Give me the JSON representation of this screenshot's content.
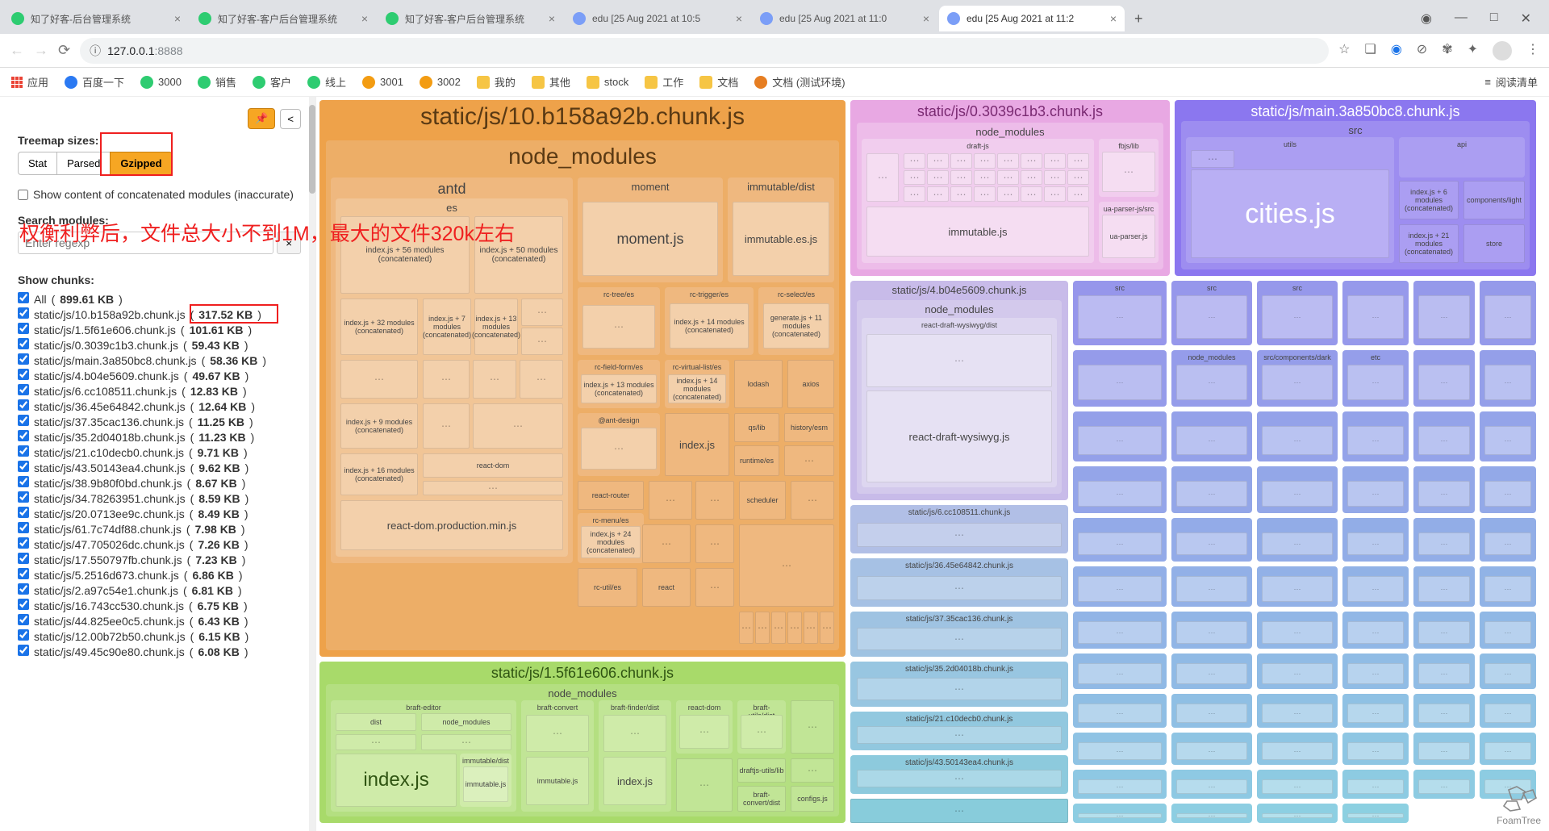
{
  "browser": {
    "tabs": [
      {
        "title": "知了好客-后台管理系统",
        "favicon": "#2ecc71"
      },
      {
        "title": "知了好客-客户后台管理系统",
        "favicon": "#2ecc71"
      },
      {
        "title": "知了好客-客户后台管理系统",
        "favicon": "#2ecc71"
      },
      {
        "title": "edu [25 Aug 2021 at 10:5",
        "favicon": "#7b9ef7"
      },
      {
        "title": "edu [25 Aug 2021 at 11:0",
        "favicon": "#7b9ef7"
      },
      {
        "title": "edu [25 Aug 2021 at 11:2",
        "favicon": "#7b9ef7",
        "active": true
      }
    ],
    "url_prefix": "ⓘ",
    "url_host": "127.0.0.1",
    "url_port": ":8888",
    "reading_list": "阅读清单"
  },
  "bookmarks": [
    {
      "label": "应用",
      "color": "#ff5722"
    },
    {
      "label": "百度一下",
      "color": "#2b79f2"
    },
    {
      "label": "3000",
      "color": "#2ecc71"
    },
    {
      "label": "销售",
      "color": "#2ecc71"
    },
    {
      "label": "客户",
      "color": "#2ecc71"
    },
    {
      "label": "线上",
      "color": "#2ecc71"
    },
    {
      "label": "3001",
      "color": "#f39c12"
    },
    {
      "label": "3002",
      "color": "#f39c12"
    },
    {
      "label": "我的",
      "folder": true
    },
    {
      "label": "其他",
      "folder": true
    },
    {
      "label": "stock",
      "folder": true
    },
    {
      "label": "工作",
      "folder": true
    },
    {
      "label": "文档",
      "folder": true
    },
    {
      "label": "文档 (测试环境)",
      "color": "#e67e22"
    }
  ],
  "sidebar": {
    "sizes_label": "Treemap sizes:",
    "stat": "Stat",
    "parsed": "Parsed",
    "gzipped": "Gzipped",
    "show_concat": "Show content of concatenated modules (inaccurate)",
    "search_label": "Search modules:",
    "search_placeholder": "Enter regexp",
    "clear": "×",
    "annotation": "权衡利弊后，文件总大小不到1M，最大的文件320k左右",
    "chunks_label": "Show chunks:",
    "chunks": [
      {
        "name": "All",
        "size": "899.61 KB"
      },
      {
        "name": "static/js/10.b158a92b.chunk.js",
        "size": "317.52 KB",
        "hl": true
      },
      {
        "name": "static/js/1.5f61e606.chunk.js",
        "size": "101.61 KB"
      },
      {
        "name": "static/js/0.3039c1b3.chunk.js",
        "size": "59.43 KB"
      },
      {
        "name": "static/js/main.3a850bc8.chunk.js",
        "size": "58.36 KB"
      },
      {
        "name": "static/js/4.b04e5609.chunk.js",
        "size": "49.67 KB"
      },
      {
        "name": "static/js/6.cc108511.chunk.js",
        "size": "12.83 KB"
      },
      {
        "name": "static/js/36.45e64842.chunk.js",
        "size": "12.64 KB"
      },
      {
        "name": "static/js/37.35cac136.chunk.js",
        "size": "11.25 KB"
      },
      {
        "name": "static/js/35.2d04018b.chunk.js",
        "size": "11.23 KB"
      },
      {
        "name": "static/js/21.c10decb0.chunk.js",
        "size": "9.71 KB"
      },
      {
        "name": "static/js/43.50143ea4.chunk.js",
        "size": "9.62 KB"
      },
      {
        "name": "static/js/38.9b80f0bd.chunk.js",
        "size": "8.67 KB"
      },
      {
        "name": "static/js/34.78263951.chunk.js",
        "size": "8.59 KB"
      },
      {
        "name": "static/js/20.0713ee9c.chunk.js",
        "size": "8.49 KB"
      },
      {
        "name": "static/js/61.7c74df88.chunk.js",
        "size": "7.98 KB"
      },
      {
        "name": "static/js/47.705026dc.chunk.js",
        "size": "7.26 KB"
      },
      {
        "name": "static/js/17.550797fb.chunk.js",
        "size": "7.23 KB"
      },
      {
        "name": "static/js/5.2516d673.chunk.js",
        "size": "6.86 KB"
      },
      {
        "name": "static/js/2.a97c54e1.chunk.js",
        "size": "6.81 KB"
      },
      {
        "name": "static/js/16.743cc530.chunk.js",
        "size": "6.75 KB"
      },
      {
        "name": "static/js/44.825ee0c5.chunk.js",
        "size": "6.43 KB"
      },
      {
        "name": "static/js/12.00b72b50.chunk.js",
        "size": "6.15 KB"
      },
      {
        "name": "static/js/49.45c90e80.chunk.js",
        "size": "6.08 KB"
      }
    ]
  },
  "treemap": {
    "chunk10": {
      "title": "static/js/10.b158a92b.chunk.js",
      "sub": "node_modules",
      "antd": "antd",
      "es": "es",
      "idx56": "index.js + 56 modules (concatenated)",
      "idx50": "index.js + 50 modules (concatenated)",
      "idx32": "index.js + 32 modules (concatenated)",
      "idx7": "index.js + 7 modules (concatenated)",
      "idx13a": "index.js + 13 modules (concatenated)",
      "idx9": "index.js + 9 modules (concatenated)",
      "idx16": "index.js + 16 modules (concatenated)",
      "rdom": "react-dom",
      "rdomprod": "react-dom.production.min.js",
      "moment": "moment",
      "momentjs": "moment.js",
      "immdist": "immutable/dist",
      "immes": "immutable.es.js",
      "rctree": "rc-tree/es",
      "rctrigger": "rc-trigger/es",
      "rcselect": "rc-select/es",
      "idx14": "index.js + 14 modules (concatenated)",
      "gen11": "generate.js + 11 modules (concatenated)",
      "rcfield": "rc-field-form/es",
      "rcvlist": "rc-virtual-list/es",
      "lodash": "lodash",
      "axios": "axios",
      "idx13b": "index.js + 13 modules (concatenated)",
      "idx14b": "index.js + 14 modules (concatenated)",
      "antdesign": "@ant-design",
      "indexjs": "index.js",
      "qs": "qs/lib",
      "runtime": "runtime/es",
      "history": "history/esm",
      "reactrouter": "react-router",
      "rcmenu": "rc-menu/es",
      "idx24": "index.js + 24 modules (concatenated)",
      "scheduler": "scheduler",
      "rcutil": "rc-util/es",
      "react": "react"
    },
    "chunk1": {
      "title": "static/js/1.5f61e606.chunk.js",
      "sub": "node_modules",
      "braft": "braft-editor",
      "dist": "dist",
      "brnm": "node_modules",
      "indexjs": "index.js",
      "bimm": "immutable/dist",
      "bimmjs": "immutable.js",
      "bconv": "braft-convert",
      "bfinder": "braft-finder/dist",
      "brutils": "braft-utils/dist",
      "rdom": "react-dom",
      "indexjs2": "index.js",
      "djlib": "draftjs-utils/lib",
      "bconvdist": "braft-convert/dist",
      "configs": "configs.js"
    },
    "chunk0": {
      "title": "static/js/0.3039c1b3.chunk.js",
      "sub": "node_modules",
      "draftjs": "draft-js",
      "fbjs": "fbjs/lib",
      "imm": "immutable.js",
      "uapsrc": "ua-parser-js/src",
      "uap": "ua-parser.js"
    },
    "main": {
      "title": "static/js/main.3a850bc8.chunk.js",
      "src": "src",
      "api": "api",
      "utils": "utils",
      "idx6": "index.js + 6 modules (concatenated)",
      "cities": "cities.js",
      "complight": "components/light",
      "store": "store",
      "idx21": "index.js + 21 modules (concatenated)"
    },
    "chunk4": {
      "title": "static/js/4.b04e5609.chunk.js",
      "sub": "node_modules",
      "rdw": "react-draft-wysiwyg/dist",
      "rdwjs": "react-draft-wysiwyg.js"
    },
    "chunk6": {
      "title": "static/js/6.cc108511.chunk.js"
    },
    "chunk36": {
      "title": "static/js/36.45e64842.chunk.js"
    },
    "chunk37": {
      "title": "static/js/37.35cac136.chunk.js"
    },
    "chunk35": {
      "title": "static/js/35.2d04018b.chunk.js"
    },
    "chunk21": {
      "title": "static/js/21.c10decb0.chunk.js"
    },
    "chunk43": {
      "title": "static/js/43.50143ea4.chunk.js"
    },
    "srcLabels": {
      "a": "src",
      "b": "src",
      "c": "src",
      "nm": "node_modules",
      "dark": "src/components/dark",
      "etc": "etc"
    },
    "logo": "FoamTree"
  }
}
